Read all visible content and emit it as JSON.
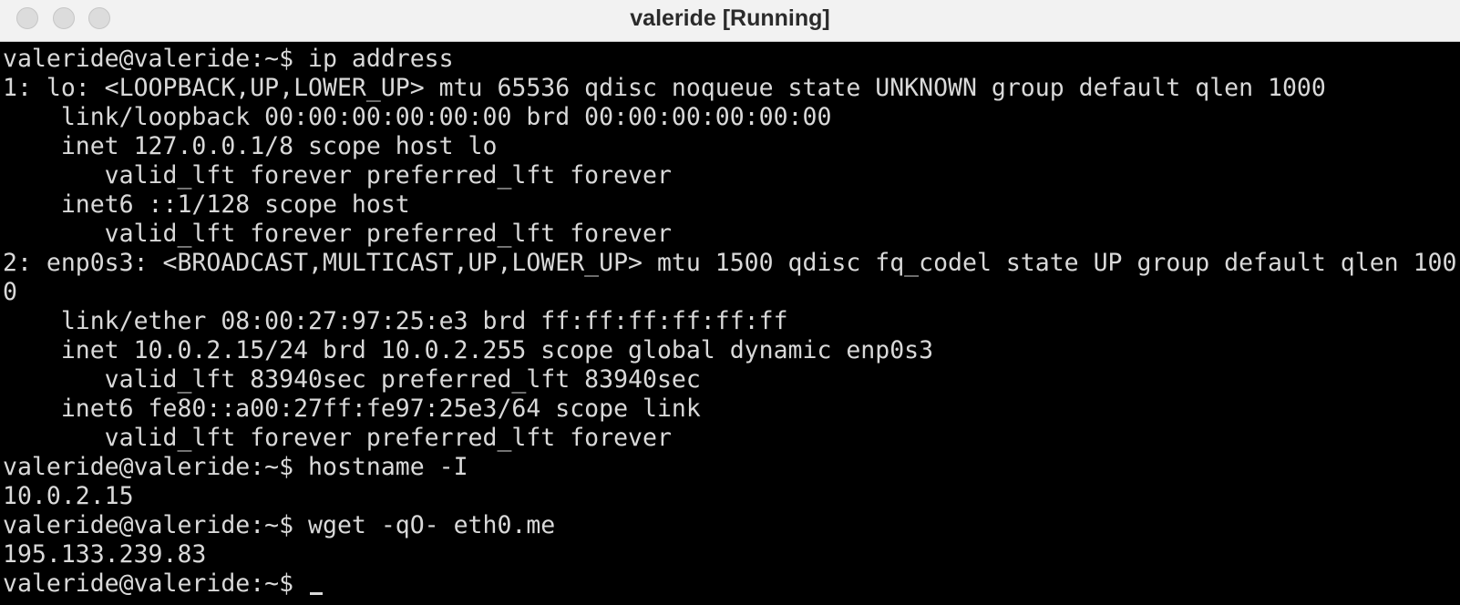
{
  "window": {
    "title": "valeride [Running]"
  },
  "colors": {
    "terminal_background": "#000000",
    "terminal_text": "#d9d9d9",
    "titlebar_background": "#f2f2f2"
  },
  "terminal": {
    "lines": [
      "valeride@valeride:~$ ip address",
      "1: lo: <LOOPBACK,UP,LOWER_UP> mtu 65536 qdisc noqueue state UNKNOWN group default qlen 1000",
      "    link/loopback 00:00:00:00:00:00 brd 00:00:00:00:00:00",
      "    inet 127.0.0.1/8 scope host lo",
      "       valid_lft forever preferred_lft forever",
      "    inet6 ::1/128 scope host",
      "       valid_lft forever preferred_lft forever",
      "2: enp0s3: <BROADCAST,MULTICAST,UP,LOWER_UP> mtu 1500 qdisc fq_codel state UP group default qlen 100",
      "0",
      "    link/ether 08:00:27:97:25:e3 brd ff:ff:ff:ff:ff:ff",
      "    inet 10.0.2.15/24 brd 10.0.2.255 scope global dynamic enp0s3",
      "       valid_lft 83940sec preferred_lft 83940sec",
      "    inet6 fe80::a00:27ff:fe97:25e3/64 scope link",
      "       valid_lft forever preferred_lft forever",
      "valeride@valeride:~$ hostname -I",
      "10.0.2.15",
      "valeride@valeride:~$ wget -qO- eth0.me",
      "195.133.239.83"
    ],
    "current_prompt": "valeride@valeride:~$ "
  }
}
